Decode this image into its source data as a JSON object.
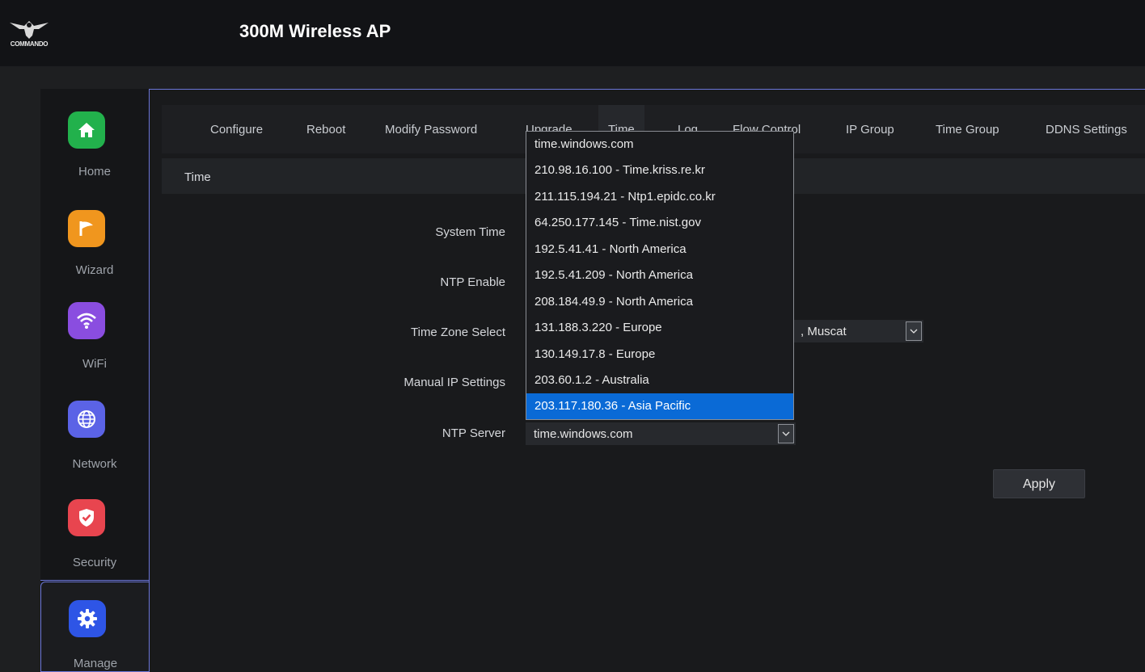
{
  "header": {
    "logo_text": "COMMANDO",
    "title": "300M Wireless AP"
  },
  "sidebar": {
    "items": [
      {
        "label": "Home",
        "icon": "home-icon",
        "color": "#22b14c"
      },
      {
        "label": "Wizard",
        "icon": "flag-icon",
        "color": "#f0961e"
      },
      {
        "label": "WiFi",
        "icon": "wifi-icon",
        "color": "#8a4de0"
      },
      {
        "label": "Network",
        "icon": "globe-icon",
        "color": "#5b63e6"
      },
      {
        "label": "Security",
        "icon": "shield-icon",
        "color": "#e8454f"
      },
      {
        "label": "Manage",
        "icon": "gear-icon",
        "color": "#2e55e6"
      }
    ],
    "active": "Manage"
  },
  "tabs": {
    "items": [
      "Configure",
      "Reboot",
      "Modify Password",
      "Upgrade",
      "Time",
      "Log",
      "Flow Control",
      "IP Group",
      "Time Group",
      "DDNS Settings"
    ],
    "active": "Time"
  },
  "section": {
    "title": "Time"
  },
  "form": {
    "system_time_label": "System Time",
    "ntp_enable_label": "NTP Enable",
    "time_zone_label": "Time Zone Select",
    "time_zone_value_visible": ", Muscat",
    "manual_ip_label": "Manual IP Settings",
    "ntp_server_label": "NTP Server",
    "ntp_server_value": "time.windows.com",
    "apply_label": "Apply"
  },
  "ntp_dropdown": {
    "options": [
      "time.windows.com",
      "210.98.16.100 - Time.kriss.re.kr",
      "211.115.194.21 - Ntp1.epidc.co.kr",
      "64.250.177.145 - Time.nist.gov",
      "192.5.41.41 - North America",
      "192.5.41.209 - North America",
      "208.184.49.9 - North America",
      "131.188.3.220 - Europe",
      "130.149.17.8 - Europe",
      "203.60.1.2 - Australia",
      "203.117.180.36 - Asia Pacific"
    ],
    "highlighted": "203.117.180.36 - Asia Pacific"
  }
}
